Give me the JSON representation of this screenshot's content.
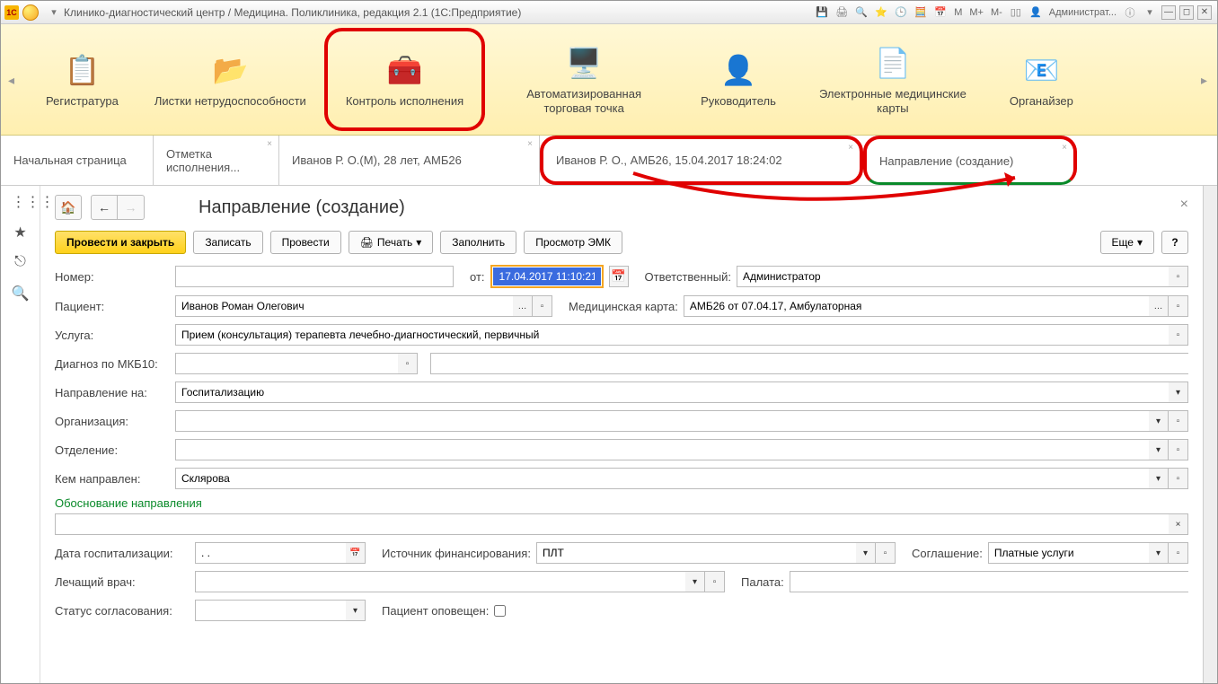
{
  "titlebar": {
    "app_logo": "1C",
    "title": "Клинико-диагностический центр / Медицина. Поликлиника, редакция 2.1  (1С:Предприятие)",
    "user_label": "Администрат...",
    "m_buttons": [
      "M",
      "M+",
      "M-"
    ]
  },
  "ribbon": {
    "items": [
      {
        "label": "Регистратура",
        "icon": "clipboard-question"
      },
      {
        "label": "Листки нетрудоспособности",
        "icon": "folder"
      },
      {
        "label": "Контроль исполнения",
        "icon": "medkit",
        "highlighted": true
      },
      {
        "label": "Автоматизированная торговая точка",
        "icon": "cash-register"
      },
      {
        "label": "Руководитель",
        "icon": "person"
      },
      {
        "label": "Электронные медицинские карты",
        "icon": "documents"
      },
      {
        "label": "Органайзер",
        "icon": "at-monitor"
      }
    ]
  },
  "tabs": [
    {
      "label": "Начальная страница",
      "closable": false
    },
    {
      "label": "Отметка исполнения...",
      "closable": true
    },
    {
      "label": "Иванов Р. О.(М), 28 лет, АМБ26",
      "closable": true
    },
    {
      "label": "Иванов Р. О., АМБ26, 15.04.2017 18:24:02",
      "closable": true,
      "highlighted": true
    },
    {
      "label": "Направление (создание)",
      "closable": true,
      "highlighted": true
    }
  ],
  "page": {
    "title": "Направление (создание)",
    "cmd": {
      "provesti_zakryt": "Провести и закрыть",
      "zapisat": "Записать",
      "provesti": "Провести",
      "pechat": "Печать",
      "zapolnit": "Заполнить",
      "prosmotr_emk": "Просмотр ЭМК",
      "eshche": "Еще"
    },
    "labels": {
      "nomer": "Номер:",
      "ot": "от:",
      "otvetstvenny": "Ответственный:",
      "pacient": "Пациент:",
      "medkarta": "Медицинская карта:",
      "usluga": "Услуга:",
      "diagnoz": "Диагноз по МКБ10:",
      "napravlenie_na": "Направление на:",
      "organizacia": "Организация:",
      "otdelenie": "Отделение:",
      "kem_napravlen": "Кем направлен:",
      "obosnovanie": "Обоснование направления",
      "data_gosp": "Дата госпитализации:",
      "istochnik_fin": "Источник финансирования:",
      "soglashenie": "Соглашение:",
      "lechashchy_vrach": "Лечащий врач:",
      "palata": "Палата:",
      "status_sogl": "Статус согласования:",
      "pacient_opoveshchen": "Пациент оповещен:"
    },
    "values": {
      "nomer": "",
      "date": "17.04.2017 11:10:21",
      "otvetstvenny": "Администратор",
      "pacient": "Иванов Роман Олегович",
      "medkarta": "АМБ26 от 07.04.17, Амбулаторная",
      "usluga": "Прием (консультация) терапевта лечебно-диагностический, первичный",
      "diagnoz1": "",
      "diagnoz2": "",
      "napravlenie_na": "Госпитализацию",
      "organizacia": "",
      "otdelenie": "",
      "kem_napravlen": "Склярова",
      "obosnovanie_text": "",
      "data_gosp": ". .",
      "istochnik_fin": "ПЛТ",
      "soglashenie": "Платные услуги",
      "lechashchy_vrach": "",
      "palata": "",
      "status_sogl": ""
    }
  }
}
